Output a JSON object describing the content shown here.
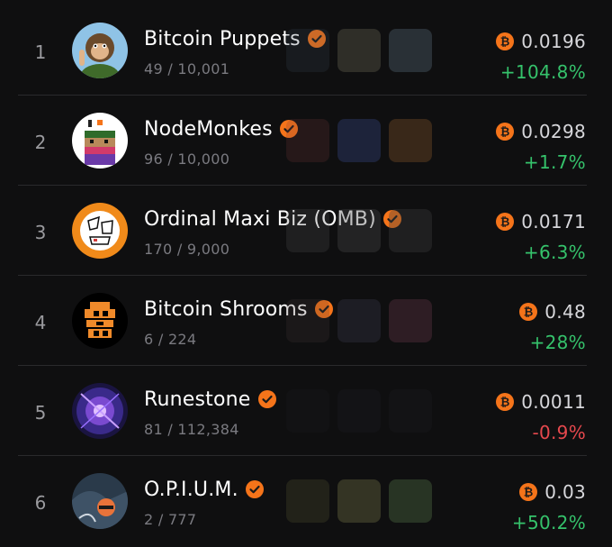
{
  "colors": {
    "accent": "#f5741a",
    "up": "#35c26b",
    "down": "#e5484d",
    "muted": "#7a7a80"
  },
  "rows": [
    {
      "rank": "1",
      "name": "Bitcoin Puppets",
      "count": "49 / 10,001",
      "price": "0.0196",
      "change": "+104.8%",
      "direction": "up"
    },
    {
      "rank": "2",
      "name": "NodeMonkes",
      "count": "96 / 10,000",
      "price": "0.0298",
      "change": "+1.7%",
      "direction": "up"
    },
    {
      "rank": "3",
      "name": "Ordinal Maxi Biz (OMB)",
      "count": "170 / 9,000",
      "price": "0.0171",
      "change": "+6.3%",
      "direction": "up"
    },
    {
      "rank": "4",
      "name": "Bitcoin Shrooms",
      "count": "6 / 224",
      "price": "0.48",
      "change": "+28%",
      "direction": "up"
    },
    {
      "rank": "5",
      "name": "Runestone",
      "count": "81 / 112,384",
      "price": "0.0011",
      "change": "-0.9%",
      "direction": "down"
    },
    {
      "rank": "6",
      "name": "O.P.I.U.M.",
      "count": "2 / 777",
      "price": "0.03",
      "change": "+50.2%",
      "direction": "up"
    }
  ],
  "icons": {
    "verified": "verified-badge-icon",
    "currency": "bitcoin-icon"
  }
}
